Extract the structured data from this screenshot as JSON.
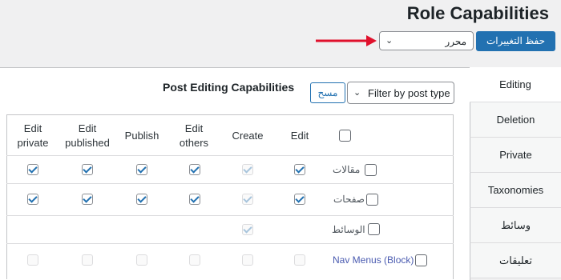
{
  "header": {
    "title": "Role Capabilities"
  },
  "role_select": {
    "value": "محرر"
  },
  "save_button": {
    "label": "حفظ التغييرات"
  },
  "section": {
    "title": "Post Editing Capabilities",
    "clear_label": "مسح",
    "filter_label": "Filter by post type"
  },
  "tabs": [
    {
      "label": "Editing"
    },
    {
      "label": "Deletion"
    },
    {
      "label": "Private"
    },
    {
      "label": "Taxonomies"
    },
    {
      "label": "وسائط"
    },
    {
      "label": "تعليقات"
    }
  ],
  "columns": [
    {
      "label": "Edit private"
    },
    {
      "label": "Edit published"
    },
    {
      "label": "Publish"
    },
    {
      "label": "Edit others"
    },
    {
      "label": "Create"
    },
    {
      "label": "Edit"
    }
  ],
  "rows": [
    {
      "label": "مقالات",
      "checks": [
        true,
        true,
        true,
        true,
        true,
        true
      ],
      "create_disabled": true
    },
    {
      "label": "صفحات",
      "checks": [
        true,
        true,
        true,
        true,
        true,
        true
      ],
      "create_disabled": true
    },
    {
      "label": "الوسائط",
      "checks": [
        false,
        false,
        false,
        false,
        true,
        false
      ],
      "create_disabled": true
    },
    {
      "label": "Nav Menus (Block)",
      "checks": [
        false,
        false,
        false,
        false,
        false,
        false
      ],
      "all_disabled": true
    }
  ],
  "colors": {
    "primary": "#2271b1",
    "arrow": "#e0102c"
  }
}
